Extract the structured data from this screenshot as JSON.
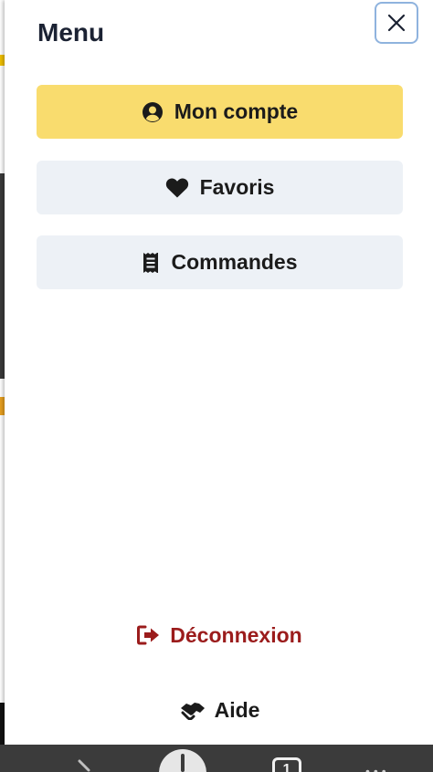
{
  "drawer": {
    "title": "Menu",
    "close_label": "Fermer"
  },
  "menu": {
    "items": [
      {
        "label": "Mon compte",
        "icon": "user-circle-icon",
        "style": "primary"
      },
      {
        "label": "Favoris",
        "icon": "heart-icon",
        "style": "secondary"
      },
      {
        "label": "Commandes",
        "icon": "receipt-icon",
        "style": "secondary"
      }
    ]
  },
  "footer": {
    "logout_label": "Déconnexion",
    "logout_icon": "sign-out-icon",
    "help_label": "Aide",
    "help_icon": "handshake-icon"
  },
  "browser_bar": {
    "tab_count": "1"
  },
  "colors": {
    "primary_button": "#f9dc6e",
    "secondary_button": "#edf1f6",
    "logout_text": "#9b1c1c",
    "title_text": "#1b2233",
    "close_border": "#8fb3de"
  }
}
